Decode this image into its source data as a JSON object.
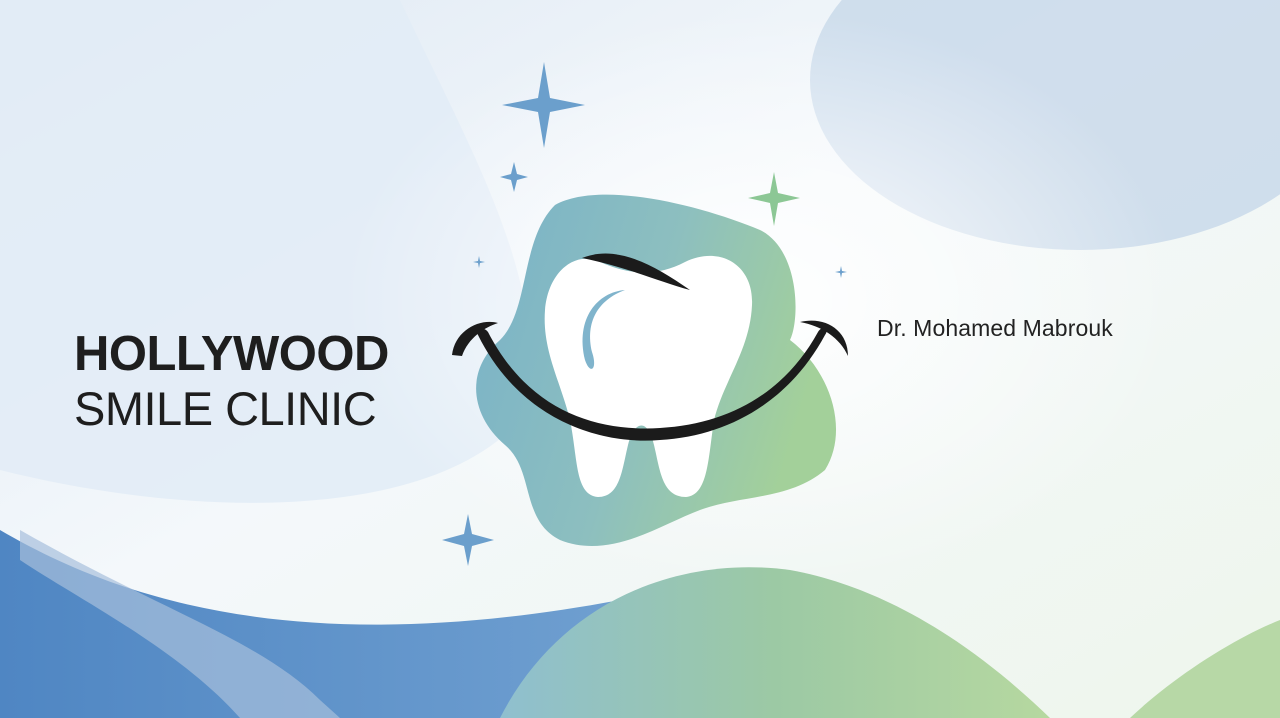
{
  "brand": {
    "line1": "HOLLYWOOD",
    "line2": "SMILE CLINIC"
  },
  "doctor": {
    "name": "Dr. Mohamed Mabrouk"
  },
  "colors": {
    "text_dark": "#1e1e1e",
    "accent_blue": "#5a8fc8",
    "accent_teal": "#7fb5c6",
    "accent_green": "#9ccc94",
    "sparkle_blue": "#6b9fcc",
    "sparkle_green": "#8cc795",
    "smile_black": "#1b1b1b"
  },
  "icons": {
    "logo": "tooth-smile-logo",
    "decor": [
      "sparkle-icon",
      "sparkle-icon",
      "sparkle-icon",
      "sparkle-icon",
      "sparkle-icon",
      "sparkle-icon"
    ]
  }
}
